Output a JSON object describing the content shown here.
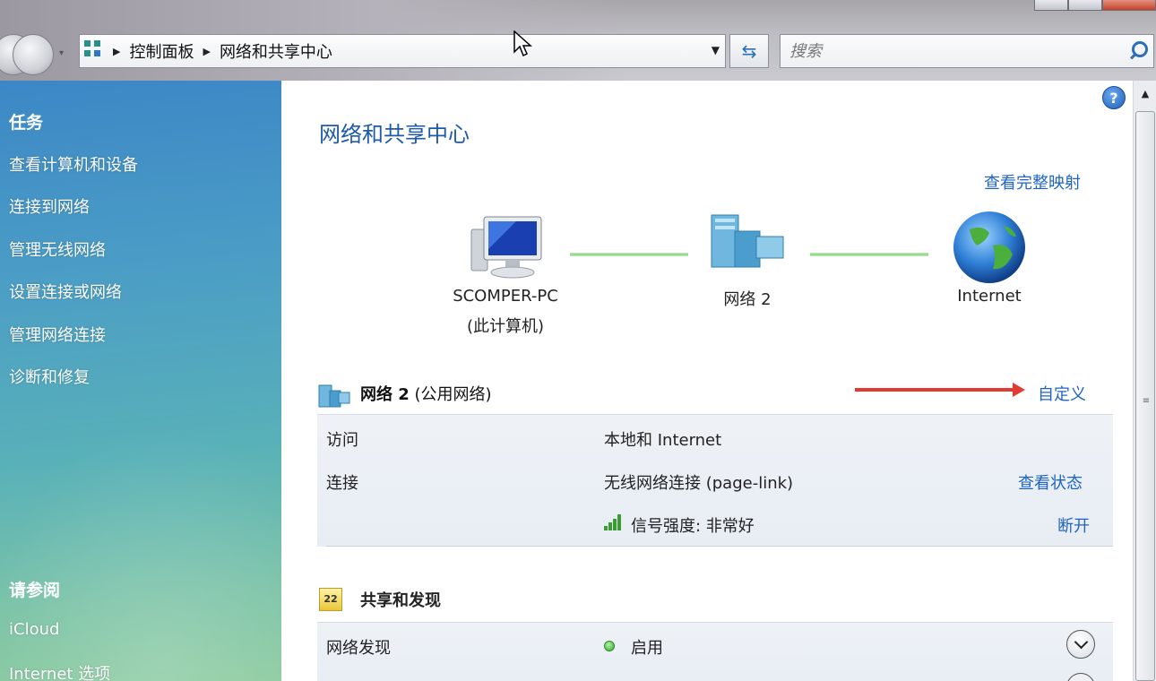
{
  "address": {
    "crumbs": [
      "控制面板",
      "网络和共享中心"
    ]
  },
  "search": {
    "placeholder": "搜索"
  },
  "sidebar": {
    "tasks_title": "任务",
    "tasks": [
      "查看计算机和设备",
      "连接到网络",
      "管理无线网络",
      "设置连接或网络",
      "管理网络连接",
      "诊断和修复"
    ],
    "see_also_title": "请参阅",
    "see_also": [
      "iCloud",
      "Internet 选项"
    ]
  },
  "main": {
    "title": "网络和共享中心",
    "view_full_map": "查看完整映射",
    "nodes": {
      "computer_name": "SCOMPER-PC",
      "computer_sub": "(此计算机)",
      "network": "网络  2",
      "internet": "Internet"
    },
    "network_section": {
      "name": "网络  2",
      "type": "(公用网络)",
      "customize": "自定义",
      "rows": {
        "access_label": "访问",
        "access_value": "本地和 Internet",
        "connection_label": "连接",
        "connection_value": "无线网络连接 (page-link)",
        "view_status": "查看状态",
        "signal_label": "信号强度:",
        "signal_value": "非常好",
        "disconnect": "断开"
      }
    },
    "sharing_section": {
      "title": "共享和发现",
      "discovery_label": "网络发现",
      "discovery_value": "启用"
    }
  },
  "colors": {
    "link": "#1f64c3",
    "title": "#1d5aa9",
    "sidebar_top": "#3c87c6",
    "sidebar_bottom": "#8ccb9f",
    "annotation_arrow": "#e23b34"
  }
}
